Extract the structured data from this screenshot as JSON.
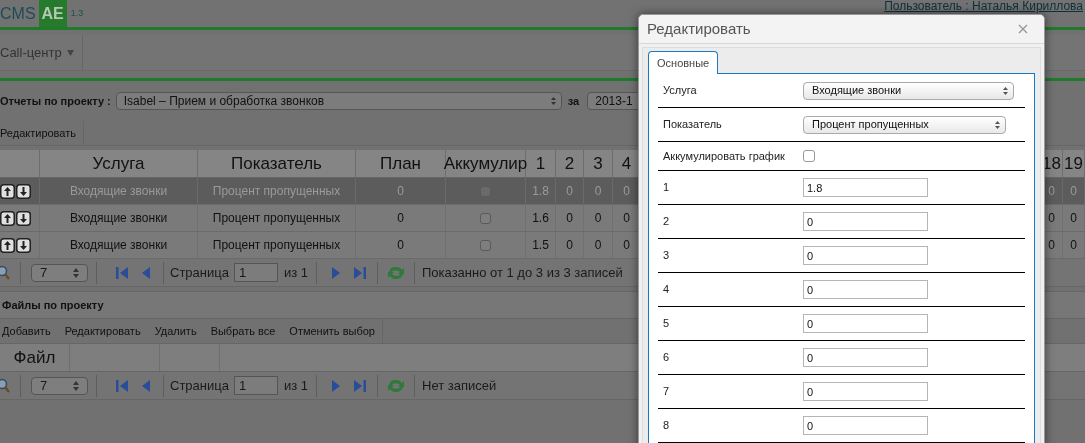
{
  "header": {
    "logo_text": "CMS",
    "logo_badge": "AE",
    "version": "1.3",
    "user": "Пользователь : Наталья Кириллова"
  },
  "nav": {
    "menu": [
      {
        "label": "Call-центр"
      }
    ]
  },
  "reports": {
    "label": "Отчеты по проекту :",
    "project": "Isabel – Прием и обработка звонков",
    "period_label": "за",
    "period": "2013-1",
    "toolbar": [
      "Редактировать"
    ],
    "columns": [
      "Услуга",
      "Показатель",
      "План",
      "Аккумулир",
      "1",
      "2",
      "3",
      "4",
      "18",
      "19"
    ],
    "rows": [
      {
        "selected": true,
        "service": "Входящие звонки",
        "indicator": "Процент пропущенных",
        "plan": "0",
        "accumulate": false,
        "days": [
          "1.8",
          "0",
          "0",
          "0",
          "0",
          "0"
        ]
      },
      {
        "selected": false,
        "service": "Входящие звонки",
        "indicator": "Процент пропущенных",
        "plan": "0",
        "accumulate": false,
        "days": [
          "1.6",
          "0",
          "0",
          "0",
          "0",
          "0"
        ]
      },
      {
        "selected": false,
        "service": "Входящие звонки",
        "indicator": "Процент пропущенных",
        "plan": "0",
        "accumulate": false,
        "days": [
          "1.5",
          "0",
          "0",
          "0",
          "0",
          "0"
        ]
      }
    ],
    "pager": {
      "page_size": "7",
      "page_label": "Страница",
      "page": "1",
      "page_total": "из 1",
      "status": "Показанно от 1 до 3 из 3 записей"
    }
  },
  "files": {
    "title": "Файлы по проекту",
    "toolbar": [
      "Добавить",
      "Редактировать",
      "Удалить",
      "Выбрать все",
      "Отменить выбор"
    ],
    "columns": [
      "Файл"
    ],
    "pager": {
      "page_size": "7",
      "page_label": "Страница",
      "page": "1",
      "page_total": "из 1",
      "status": "Нет записей"
    }
  },
  "dialog": {
    "title": "Редактировать",
    "tabs": [
      {
        "label": "Основные",
        "selected": true
      }
    ],
    "fields": [
      {
        "kind": "select",
        "label": "Услуга",
        "value": "Входящие звонки"
      },
      {
        "kind": "select",
        "label": "Показатель",
        "value": "Процент пропущенных"
      },
      {
        "kind": "checkbox",
        "label": "Аккумулировать график",
        "checked": false
      },
      {
        "kind": "input",
        "label": "1",
        "value": "1.8"
      },
      {
        "kind": "input",
        "label": "2",
        "value": "0"
      },
      {
        "kind": "input",
        "label": "3",
        "value": "0"
      },
      {
        "kind": "input",
        "label": "4",
        "value": "0"
      },
      {
        "kind": "input",
        "label": "5",
        "value": "0"
      },
      {
        "kind": "input",
        "label": "6",
        "value": "0"
      },
      {
        "kind": "input",
        "label": "7",
        "value": "0"
      },
      {
        "kind": "input",
        "label": "8",
        "value": "0"
      }
    ]
  }
}
